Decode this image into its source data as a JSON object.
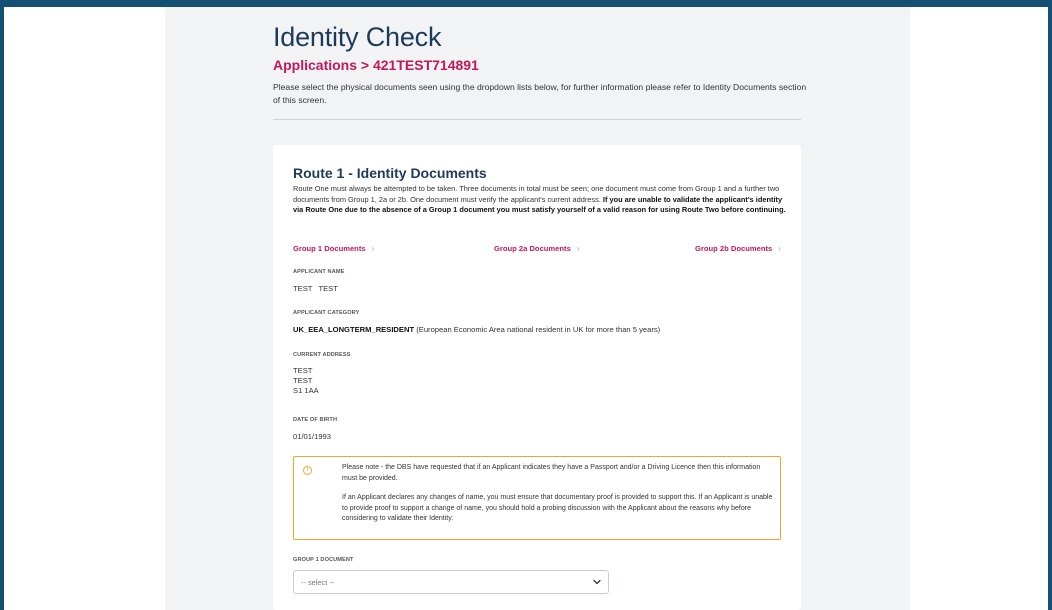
{
  "page": {
    "title": "Identity Check",
    "breadcrumb": {
      "parent": "Applications",
      "separator": ">",
      "current": "421TEST714891"
    },
    "intro": "Please select the physical documents seen using the dropdown lists below, for further information please refer to Identity Documents section of this screen."
  },
  "card": {
    "title": "Route 1 - Identity Documents",
    "description": "Route One must always be attempted to be taken. Three documents in total must be seen; one document must come from Group 1 and a further two documents from Group 1, 2a or 2b. One document must verify the applicant's current address. ",
    "description_bold": "If you are unable to validate the applicant's identity via Route One due to the absence of a Group 1 document you must satisfy yourself of a valid reason for using Route Two before continuing.",
    "groups": [
      {
        "label": "Group 1 Documents"
      },
      {
        "label": "Group 2a Documents"
      },
      {
        "label": "Group 2b Documents"
      }
    ],
    "fields": {
      "applicant_name_label": "APPLICANT NAME",
      "applicant_name": "TEST   TEST",
      "applicant_category_label": "APPLICANT CATEGORY",
      "applicant_category_code": "UK_EEA_LONGTERM_RESIDENT",
      "applicant_category_desc": " (European Economic Area national resident in UK for more than 5 years)",
      "current_address_label": "CURRENT ADDRESS",
      "address_lines": [
        "TEST",
        "TEST",
        "S1 1AA"
      ],
      "dob_label": "DATE OF BIRTH",
      "dob": "01/01/1993"
    },
    "notice": {
      "icon": "info-circle-icon",
      "paragraph1": "Please note - the DBS have requested that if an Applicant indicates they have a Passport and/or a Driving Licence then this information must be provided.",
      "paragraph2": "If an Applicant declares any changes of name, you must ensure that documentary proof is provided to support this. If an Applicant is unable to provide proof to support a change of name, you should hold a probing discussion with the Applicant about the reasons why before considering to validate their Identity."
    },
    "group1_select": {
      "label": "GROUP 1 DOCUMENT",
      "selected": "-- select --"
    }
  },
  "colors": {
    "frame": "#145074",
    "accent": "#c2185b",
    "heading": "#1e3a5a",
    "warning": "#f0a531"
  }
}
